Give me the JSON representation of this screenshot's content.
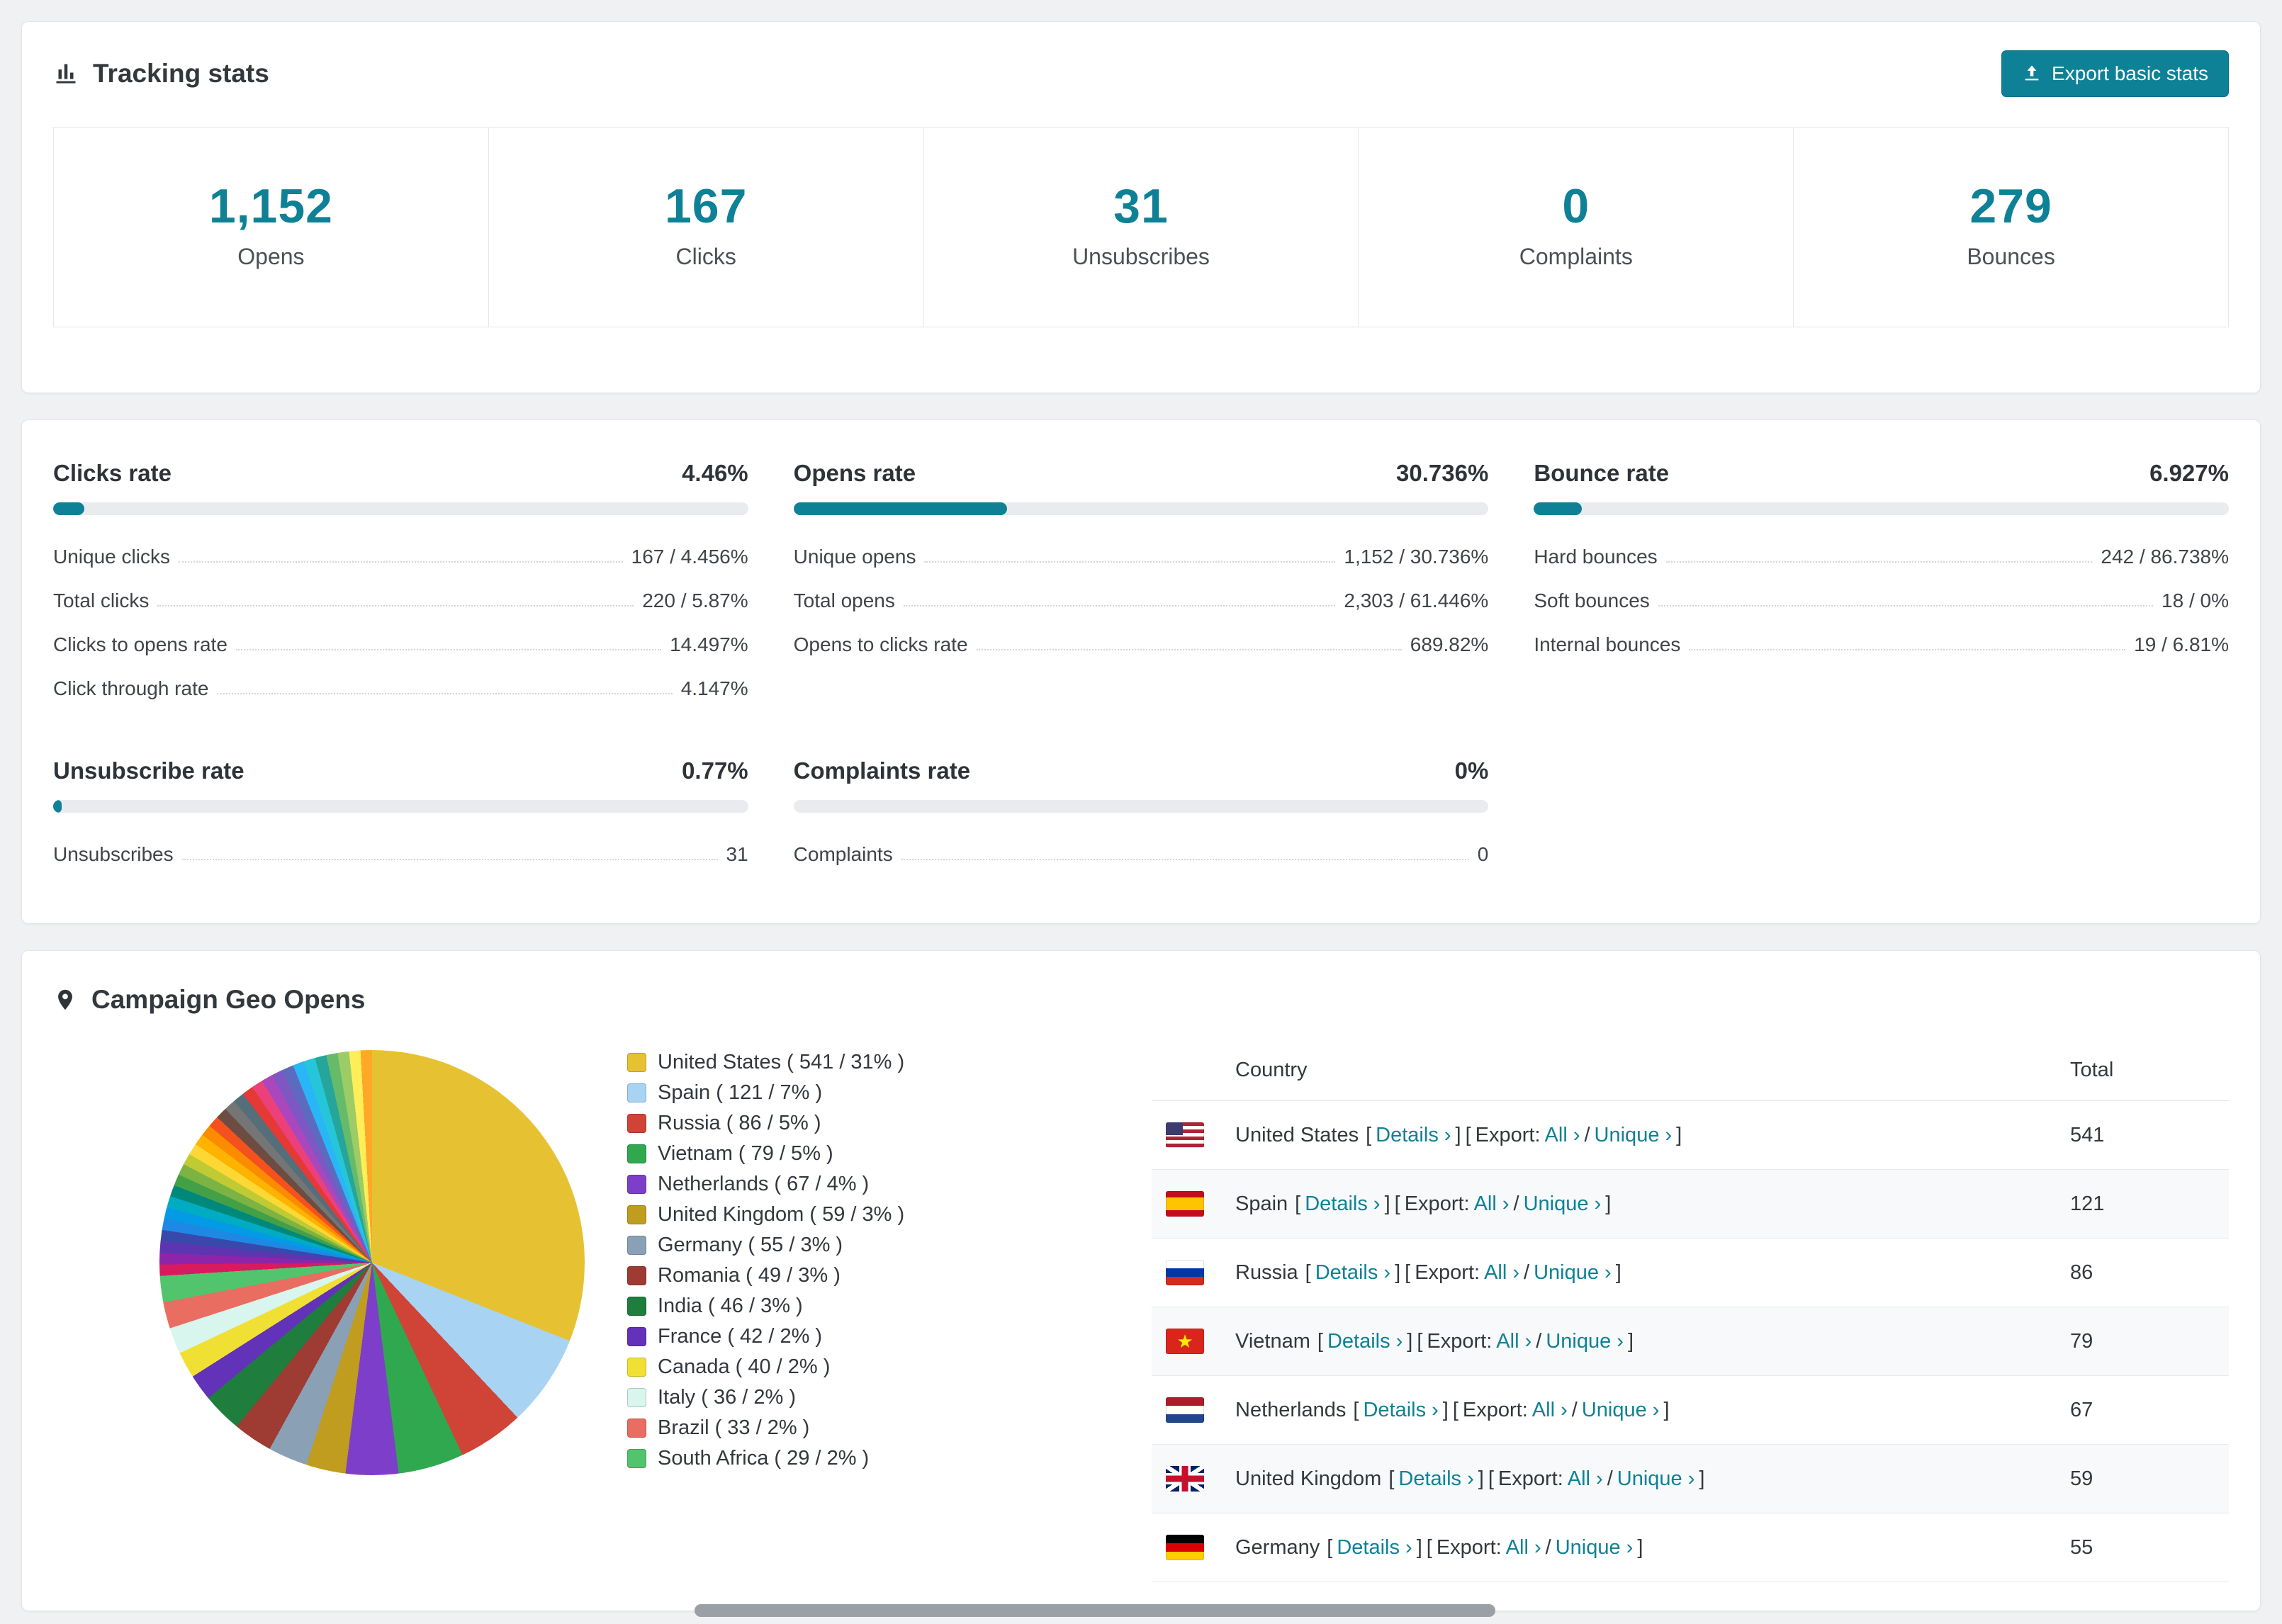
{
  "colors": {
    "accent": "#0e8196",
    "bar_track": "#e9ebee"
  },
  "tracking": {
    "title": "Tracking stats",
    "export_button": "Export basic stats",
    "stats": [
      {
        "value": "1,152",
        "label": "Opens"
      },
      {
        "value": "167",
        "label": "Clicks"
      },
      {
        "value": "31",
        "label": "Unsubscribes"
      },
      {
        "value": "0",
        "label": "Complaints"
      },
      {
        "value": "279",
        "label": "Bounces"
      }
    ]
  },
  "rates": {
    "blocks": [
      {
        "title": "Clicks rate",
        "value": "4.46%",
        "pct": 4.46,
        "rows": [
          [
            "Unique clicks",
            "167 / 4.456%"
          ],
          [
            "Total clicks",
            "220 / 5.87%"
          ],
          [
            "Clicks to opens rate",
            "14.497%"
          ],
          [
            "Click through rate",
            "4.147%"
          ]
        ]
      },
      {
        "title": "Opens rate",
        "value": "30.736%",
        "pct": 30.736,
        "rows": [
          [
            "Unique opens",
            "1,152 / 30.736%"
          ],
          [
            "Total opens",
            "2,303 / 61.446%"
          ],
          [
            "Opens to clicks rate",
            "689.82%"
          ]
        ]
      },
      {
        "title": "Bounce rate",
        "value": "6.927%",
        "pct": 6.927,
        "rows": [
          [
            "Hard bounces",
            "242 / 86.738%"
          ],
          [
            "Soft bounces",
            "18 / 0%"
          ],
          [
            "Internal bounces",
            "19 / 6.81%"
          ]
        ]
      },
      {
        "title": "Unsubscribe rate",
        "value": "0.77%",
        "pct": 0.77,
        "rows": [
          [
            "Unsubscribes",
            "31"
          ]
        ]
      },
      {
        "title": "Complaints rate",
        "value": "0%",
        "pct": 0,
        "rows": [
          [
            "Complaints",
            "0"
          ]
        ]
      }
    ]
  },
  "geo": {
    "title": "Campaign Geo Opens",
    "chart_data": {
      "type": "pie",
      "title": "Campaign Geo Opens",
      "legend_position": "right",
      "series": [
        {
          "label": "United States",
          "value": 541,
          "percent": 31,
          "color": "#e6c233"
        },
        {
          "label": "Spain",
          "value": 121,
          "percent": 7,
          "color": "#a8d3f2"
        },
        {
          "label": "Russia",
          "value": 86,
          "percent": 5,
          "color": "#cf4436"
        },
        {
          "label": "Vietnam",
          "value": 79,
          "percent": 5,
          "color": "#2fa84f"
        },
        {
          "label": "Netherlands",
          "value": 67,
          "percent": 4,
          "color": "#7d3fc9"
        },
        {
          "label": "United Kingdom",
          "value": 59,
          "percent": 3,
          "color": "#c09c1f"
        },
        {
          "label": "Germany",
          "value": 55,
          "percent": 3,
          "color": "#8aa0b4"
        },
        {
          "label": "Romania",
          "value": 49,
          "percent": 3,
          "color": "#9e3b33"
        },
        {
          "label": "India",
          "value": 46,
          "percent": 3,
          "color": "#1f7d3e"
        },
        {
          "label": "France",
          "value": 42,
          "percent": 2,
          "color": "#6233b8"
        },
        {
          "label": "Canada",
          "value": 40,
          "percent": 2,
          "color": "#f1e034"
        },
        {
          "label": "Italy",
          "value": 36,
          "percent": 2,
          "color": "#d8f5ee"
        },
        {
          "label": "Brazil",
          "value": 33,
          "percent": 2,
          "color": "#e96d60"
        },
        {
          "label": "South Africa",
          "value": 29,
          "percent": 2,
          "color": "#52c46d"
        }
      ],
      "others": {
        "percent": 26,
        "colors": [
          "#d81b60",
          "#8e24aa",
          "#5e35b1",
          "#3949ab",
          "#1e88e5",
          "#039be5",
          "#00acc1",
          "#00897b",
          "#43a047",
          "#7cb342",
          "#c0ca33",
          "#fdd835",
          "#ffb300",
          "#fb8c00",
          "#f4511e",
          "#6d4c41",
          "#757575",
          "#546e7a",
          "#e53935",
          "#ec407a",
          "#ab47bc",
          "#7e57c2",
          "#5c6bc0",
          "#29b6f6",
          "#26c6da",
          "#26a69a",
          "#66bb6a",
          "#9ccc65",
          "#ffee58",
          "#ffa726"
        ]
      }
    },
    "table": {
      "headers": [
        "Country",
        "Total"
      ],
      "link_details": "Details ›",
      "link_export_prefix": "Export:",
      "link_all": "All ›",
      "link_sep": "/",
      "link_unique": "Unique ›",
      "rows": [
        {
          "country": "United States",
          "code": "us",
          "total": "541"
        },
        {
          "country": "Spain",
          "code": "es",
          "total": "121"
        },
        {
          "country": "Russia",
          "code": "ru",
          "total": "86"
        },
        {
          "country": "Vietnam",
          "code": "vn",
          "total": "79"
        },
        {
          "country": "Netherlands",
          "code": "nl",
          "total": "67"
        },
        {
          "country": "United Kingdom",
          "code": "gb",
          "total": "59"
        },
        {
          "country": "Germany",
          "code": "de",
          "total": "55"
        }
      ]
    }
  }
}
